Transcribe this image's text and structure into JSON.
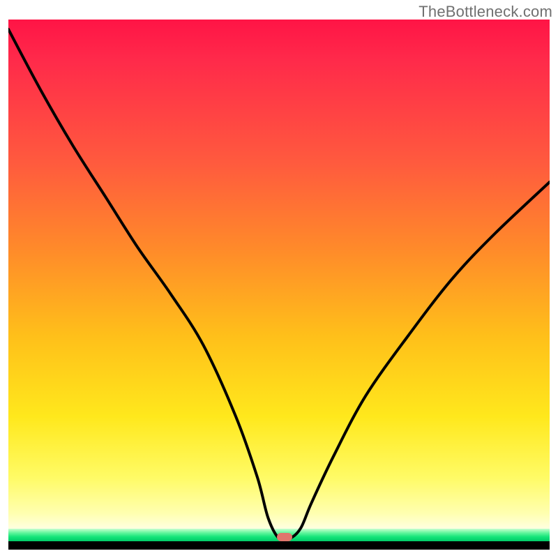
{
  "watermark": {
    "text": "TheBottleneck.com"
  },
  "chart_data": {
    "type": "line",
    "title": "",
    "xlabel": "",
    "ylabel": "",
    "axes_visible": false,
    "xlim": [
      0,
      100
    ],
    "ylim": [
      0,
      100
    ],
    "background_gradient": {
      "direction": "vertical",
      "stops": [
        {
          "pos": 0,
          "color": "#ff1446"
        },
        {
          "pos": 28,
          "color": "#ff5a3e"
        },
        {
          "pos": 62,
          "color": "#ffbf1a"
        },
        {
          "pos": 90,
          "color": "#fffb66"
        },
        {
          "pos": 97,
          "color": "#ffffe0"
        },
        {
          "pos": 98,
          "color": "#5cf59a"
        },
        {
          "pos": 100,
          "color": "#00cb68"
        }
      ]
    },
    "series": [
      {
        "name": "bottleneck-curve",
        "color": "#000000",
        "x": [
          0,
          6,
          12,
          18,
          24,
          30,
          36,
          42,
          46,
          48,
          50,
          52,
          54,
          56,
          60,
          66,
          74,
          82,
          90,
          100
        ],
        "y": [
          100,
          88,
          77,
          67,
          57,
          48,
          38,
          24,
          12,
          4,
          0,
          0,
          2,
          7,
          16,
          28,
          40,
          51,
          60,
          70
        ]
      }
    ],
    "marker": {
      "x": 51,
      "y": 0,
      "color": "#e0756c",
      "shape": "pill"
    }
  }
}
